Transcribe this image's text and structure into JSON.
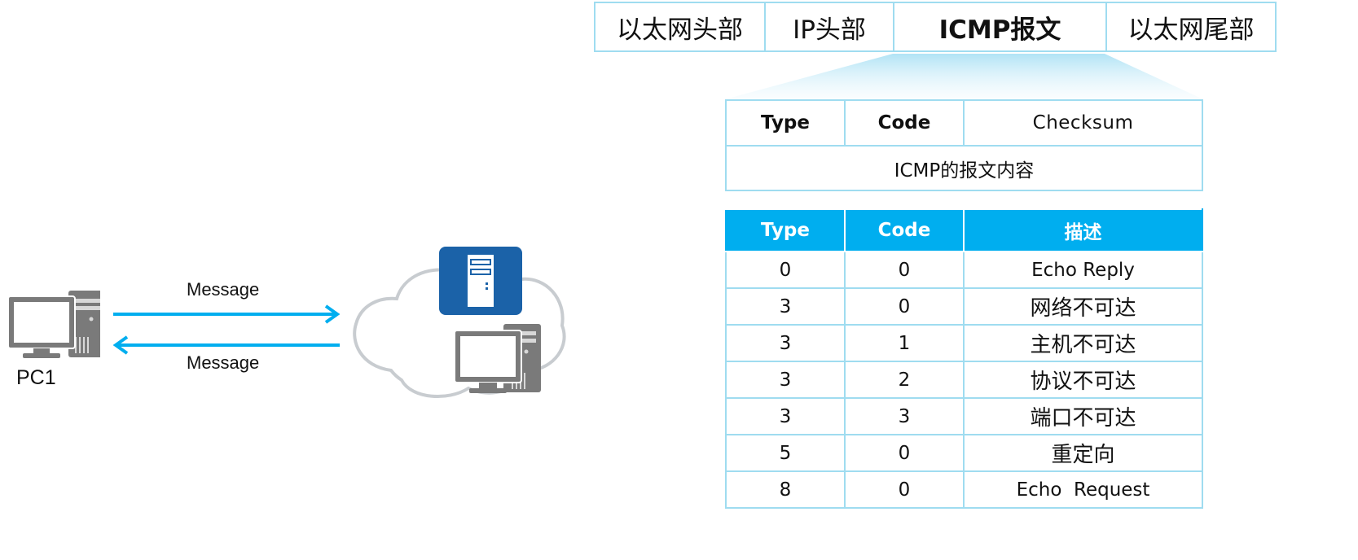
{
  "frame": {
    "cells": [
      "以太网头部",
      "IP头部",
      "ICMP报文",
      "以太网尾部"
    ]
  },
  "icmp_header": {
    "type_label": "Type",
    "code_label": "Code",
    "checksum_label": "Checksum",
    "content_label": "ICMP的报文内容"
  },
  "icmp_table": {
    "headers": [
      "Type",
      "Code",
      "描述"
    ],
    "rows": [
      [
        "0",
        "0",
        "Echo Reply"
      ],
      [
        "3",
        "0",
        "网络不可达"
      ],
      [
        "3",
        "1",
        "主机不可达"
      ],
      [
        "3",
        "2",
        "协议不可达"
      ],
      [
        "3",
        "3",
        "端口不可达"
      ],
      [
        "5",
        "0",
        "重定向"
      ],
      [
        "8",
        "0",
        "Echo  Request"
      ]
    ]
  },
  "diagram": {
    "msg_top": "Message",
    "msg_bottom": "Message",
    "pc_label": "PC1"
  },
  "colors": {
    "accent": "#00aeef",
    "border": "#9fdcf0",
    "server_blue": "#1b62a8",
    "pc_gray": "#7a7a7a",
    "cloud": "#c8ccd0"
  }
}
